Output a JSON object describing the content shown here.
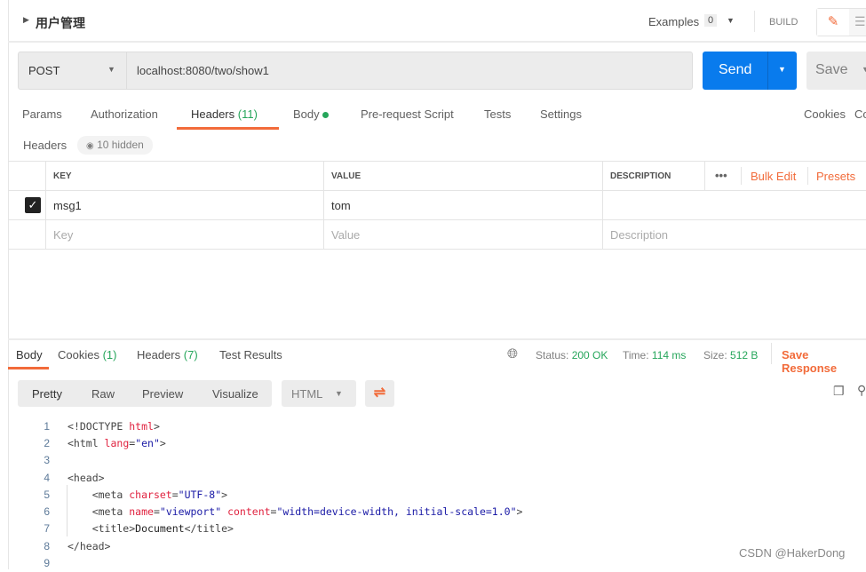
{
  "header": {
    "title": "用户管理",
    "examples_label": "Examples",
    "examples_count": "0",
    "build_label": "BUILD"
  },
  "request": {
    "method": "POST",
    "url": "localhost:8080/two/show1",
    "send_label": "Send",
    "save_label": "Save"
  },
  "req_tabs": [
    {
      "label": "Params"
    },
    {
      "label": "Authorization"
    },
    {
      "label": "Headers",
      "count": "(11)"
    },
    {
      "label": "Body"
    },
    {
      "label": "Pre-request Script"
    },
    {
      "label": "Tests"
    },
    {
      "label": "Settings"
    }
  ],
  "cookies_link": "Cookies",
  "code_link": "Co",
  "headers_section": {
    "label": "Headers",
    "hidden": "10 hidden"
  },
  "table": {
    "columns": [
      "KEY",
      "VALUE",
      "DESCRIPTION"
    ],
    "bulk_edit": "Bulk Edit",
    "presets": "Presets",
    "rows": [
      {
        "checked": true,
        "key": "msg1",
        "value": "tom",
        "description": ""
      }
    ],
    "placeholder": {
      "key": "Key",
      "value": "Value",
      "description": "Description"
    }
  },
  "response": {
    "tabs": [
      {
        "label": "Body"
      },
      {
        "label": "Cookies",
        "count": "(1)"
      },
      {
        "label": "Headers",
        "count": "(7)"
      },
      {
        "label": "Test Results"
      }
    ],
    "status_label": "Status:",
    "status": "200 OK",
    "time_label": "Time:",
    "time": "114 ms",
    "size_label": "Size:",
    "size": "512 B",
    "save_response": "Save Response",
    "views": [
      "Pretty",
      "Raw",
      "Preview",
      "Visualize"
    ],
    "format": "HTML"
  },
  "code": [
    [
      [
        "p",
        "<"
      ],
      [
        "p",
        "!DOCTYPE "
      ],
      [
        "attr",
        "html"
      ],
      [
        "p",
        ">"
      ]
    ],
    [
      [
        "p",
        "<html "
      ],
      [
        "attr",
        "lang"
      ],
      [
        "p",
        "="
      ],
      [
        "str",
        "\"en\""
      ],
      [
        "p",
        ">"
      ]
    ],
    [],
    [
      [
        "p",
        "<head>"
      ]
    ],
    [
      [
        "p",
        "    <meta "
      ],
      [
        "attr",
        "charset"
      ],
      [
        "p",
        "="
      ],
      [
        "str",
        "\"UTF-8\""
      ],
      [
        "p",
        ">"
      ]
    ],
    [
      [
        "p",
        "    <meta "
      ],
      [
        "attr",
        "name"
      ],
      [
        "p",
        "="
      ],
      [
        "str",
        "\"viewport\""
      ],
      [
        "p",
        " "
      ],
      [
        "attr",
        "content"
      ],
      [
        "p",
        "="
      ],
      [
        "str",
        "\"width=device-width, initial-scale=1.0\""
      ],
      [
        "p",
        ">"
      ]
    ],
    [
      [
        "p",
        "    <title>"
      ],
      [
        "text",
        "Document"
      ],
      [
        "p",
        "</title>"
      ]
    ],
    [
      [
        "p",
        "</head>"
      ]
    ],
    []
  ],
  "watermark": "CSDN @HakerDong",
  "colors": {
    "accent": "#f26b3a",
    "send": "#097bed",
    "success": "#26a65b"
  }
}
